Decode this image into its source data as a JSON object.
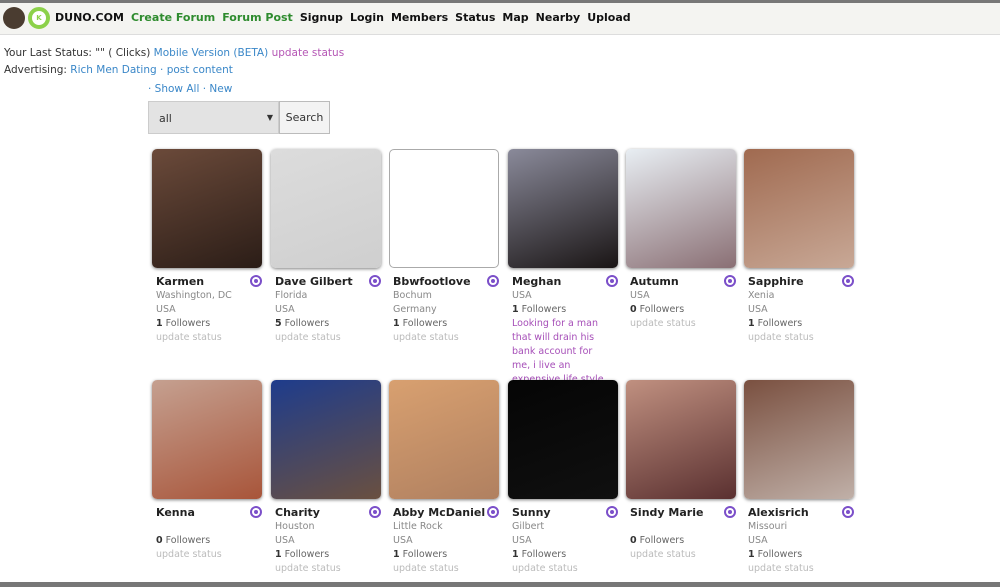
{
  "nav": {
    "site": "DUNO.COM",
    "items": [
      {
        "label": "Create Forum",
        "color": "#2e8b2e"
      },
      {
        "label": "Forum Post",
        "color": "#2e8b2e"
      },
      {
        "label": "Signup"
      },
      {
        "label": "Login"
      },
      {
        "label": "Members"
      },
      {
        "label": "Status"
      },
      {
        "label": "Map"
      },
      {
        "label": "Nearby"
      },
      {
        "label": "Upload"
      }
    ]
  },
  "status": {
    "prefix": "Your Last Status: \"\" ( Clicks)",
    "mobile": "Mobile Version (BETA)",
    "update": "update status",
    "ad_label": "Advertising:",
    "ad_link": "Rich Men Dating",
    "sep": "·",
    "post": "post content"
  },
  "filter": {
    "show_all": "· Show All",
    "new": "· New",
    "select_value": "all",
    "search_label": "Search"
  },
  "members": [
    {
      "name": "Karmen",
      "lines": [
        "Washington, DC",
        "USA"
      ],
      "followers": "1",
      "status": "update status",
      "own": true,
      "photo": [
        "#6b4a3a",
        "#2b1d17"
      ]
    },
    {
      "name": "Dave Gilbert",
      "lines": [
        "Florida",
        "USA"
      ],
      "followers": "5",
      "status": "update status",
      "own": true,
      "photo": [
        "#dcdcdc",
        "#cfcfcf"
      ]
    },
    {
      "name": "Bbwfootlove",
      "lines": [
        "Bochum",
        "Germany"
      ],
      "followers": "1",
      "status": "update status",
      "own": true,
      "photo": [
        "#ffffff",
        "#ffffff"
      ]
    },
    {
      "name": "Meghan",
      "lines": [
        "USA"
      ],
      "followers": "1",
      "status": "Looking for a man that will drain his bank account for me, i live an expensive life style :)",
      "own": false,
      "photo": [
        "#8a8a9a",
        "#1a1515"
      ]
    },
    {
      "name": "Autumn",
      "lines": [
        "USA"
      ],
      "followers": "0",
      "status": "update status",
      "own": true,
      "photo": [
        "#e8eef3",
        "#8a6f74"
      ]
    },
    {
      "name": "Sapphire",
      "lines": [
        "Xenia",
        "USA"
      ],
      "followers": "1",
      "status": "update status",
      "own": true,
      "photo": [
        "#a06a50",
        "#c8a896"
      ]
    },
    {
      "name": "Kenna",
      "lines": [
        ""
      ],
      "followers": "0",
      "status": "update status",
      "own": true,
      "photo": [
        "#c5a090",
        "#a8553a"
      ]
    },
    {
      "name": "Charity",
      "lines": [
        "Houston",
        "USA"
      ],
      "followers": "1",
      "status": "update status",
      "own": true,
      "photo": [
        "#1e3c8c",
        "#6a5040"
      ]
    },
    {
      "name": "Abby McDaniel",
      "lines": [
        "Little Rock",
        "USA"
      ],
      "followers": "1",
      "status": "update status",
      "own": true,
      "photo": [
        "#d8a070",
        "#b08060"
      ]
    },
    {
      "name": "Sunny",
      "lines": [
        "Gilbert",
        "USA"
      ],
      "followers": "1",
      "status": "update status",
      "own": true,
      "photo": [
        "#050505",
        "#101010"
      ]
    },
    {
      "name": "Sindy Marie",
      "lines": [
        ""
      ],
      "followers": "0",
      "status": "update status",
      "own": true,
      "photo": [
        "#c09080",
        "#5a3030"
      ]
    },
    {
      "name": "Alexisrich",
      "lines": [
        "Missouri",
        "USA"
      ],
      "followers": "1",
      "status": "update status",
      "own": true,
      "photo": [
        "#7a5040",
        "#c0b0a8"
      ]
    }
  ],
  "followers_label": "Followers"
}
